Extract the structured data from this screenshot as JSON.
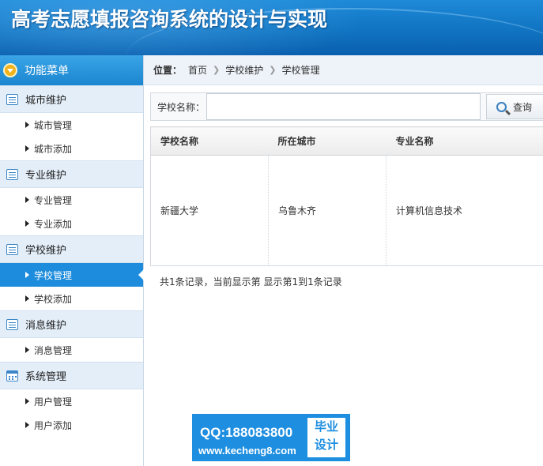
{
  "header": {
    "title": "高考志愿填报咨询系统的设计与实现"
  },
  "sidebar": {
    "menu_title": "功能菜单",
    "groups": [
      {
        "label": "城市维护",
        "icon": "list-icon",
        "items": [
          {
            "label": "城市管理"
          },
          {
            "label": "城市添加"
          }
        ]
      },
      {
        "label": "专业维护",
        "icon": "list-icon",
        "items": [
          {
            "label": "专业管理"
          },
          {
            "label": "专业添加"
          }
        ]
      },
      {
        "label": "学校维护",
        "icon": "list-icon",
        "items": [
          {
            "label": "学校管理",
            "active": true
          },
          {
            "label": "学校添加"
          }
        ]
      },
      {
        "label": "消息维护",
        "icon": "list-icon",
        "items": [
          {
            "label": "消息管理"
          }
        ]
      },
      {
        "label": "系统管理",
        "icon": "calendar-icon",
        "items": [
          {
            "label": "用户管理"
          },
          {
            "label": "用户添加"
          }
        ]
      }
    ]
  },
  "breadcrumb": {
    "label": "位置：",
    "items": [
      "首页",
      "学校维护",
      "学校管理"
    ]
  },
  "search": {
    "label": "学校名称：",
    "value": "",
    "placeholder": "",
    "button_label": "查询"
  },
  "table": {
    "columns": [
      "学校名称",
      "所在城市",
      "专业名称"
    ],
    "rows": [
      [
        "新疆大学",
        "乌鲁木齐",
        "计算机信息技术"
      ]
    ]
  },
  "summary": "共1条记录，当前显示第  显示第1到1条记录",
  "watermark": {
    "qq": "QQ:188083800",
    "site": "www.kecheng8.com",
    "badge_top": "毕业",
    "badge_bottom": "设计"
  },
  "colors": {
    "accent": "#1d8cdc",
    "header": "#1074c2",
    "group_bg": "#e4eef8"
  }
}
